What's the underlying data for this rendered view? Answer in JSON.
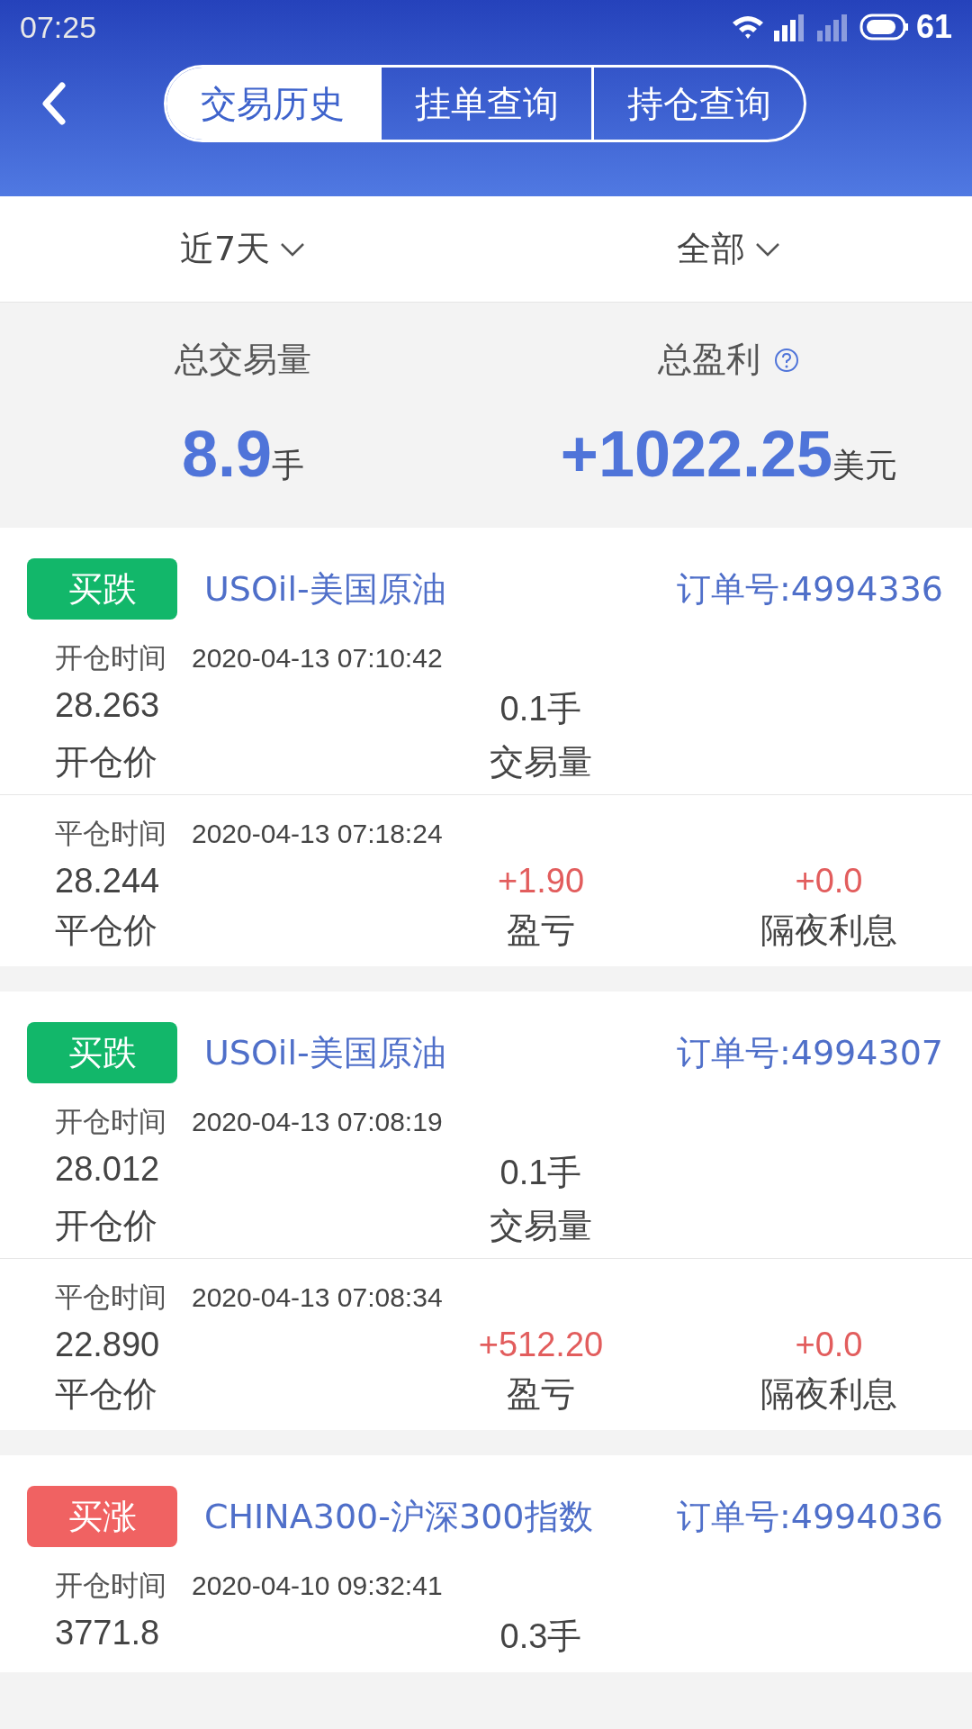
{
  "status_bar": {
    "time": "07:25",
    "battery": "61"
  },
  "tabs": [
    {
      "label": "交易历史",
      "selected": true
    },
    {
      "label": "挂单查询",
      "selected": false
    },
    {
      "label": "持仓查询",
      "selected": false
    }
  ],
  "filters": [
    {
      "label": "近7天"
    },
    {
      "label": "全部"
    }
  ],
  "summary": {
    "volume_label": "总交易量",
    "volume_value": "8.9",
    "volume_unit": "手",
    "profit_label": "总盈利",
    "profit_value": "+1022.25",
    "profit_unit": "美元"
  },
  "orders": [
    {
      "kind": "sell",
      "tag": "买跌",
      "symbol": "USOil-美国原油",
      "order_no": "订单号:4994336",
      "open": {
        "time_label": "开仓时间",
        "time": "2020-04-13 07:10:42",
        "price": "28.263",
        "price_label": "开仓价",
        "volume": "0.1手",
        "volume_label": "交易量"
      },
      "close": {
        "time_label": "平仓时间",
        "time": "2020-04-13 07:18:24",
        "price": "28.244",
        "price_label": "平仓价",
        "pnl": "+1.90",
        "pnl_label": "盈亏",
        "swap": "+0.0",
        "swap_label": "隔夜利息"
      }
    },
    {
      "kind": "sell",
      "tag": "买跌",
      "symbol": "USOil-美国原油",
      "order_no": "订单号:4994307",
      "open": {
        "time_label": "开仓时间",
        "time": "2020-04-13 07:08:19",
        "price": "28.012",
        "price_label": "开仓价",
        "volume": "0.1手",
        "volume_label": "交易量"
      },
      "close": {
        "time_label": "平仓时间",
        "time": "2020-04-13 07:08:34",
        "price": "22.890",
        "price_label": "平仓价",
        "pnl": "+512.20",
        "pnl_label": "盈亏",
        "swap": "+0.0",
        "swap_label": "隔夜利息"
      }
    },
    {
      "kind": "buy",
      "tag": "买涨",
      "symbol": "CHINA300-沪深300指数",
      "order_no": "订单号:4994036",
      "open": {
        "time_label": "开仓时间",
        "time": "2020-04-10 09:32:41",
        "price": "3771.8",
        "volume": "0.3手"
      }
    }
  ]
}
